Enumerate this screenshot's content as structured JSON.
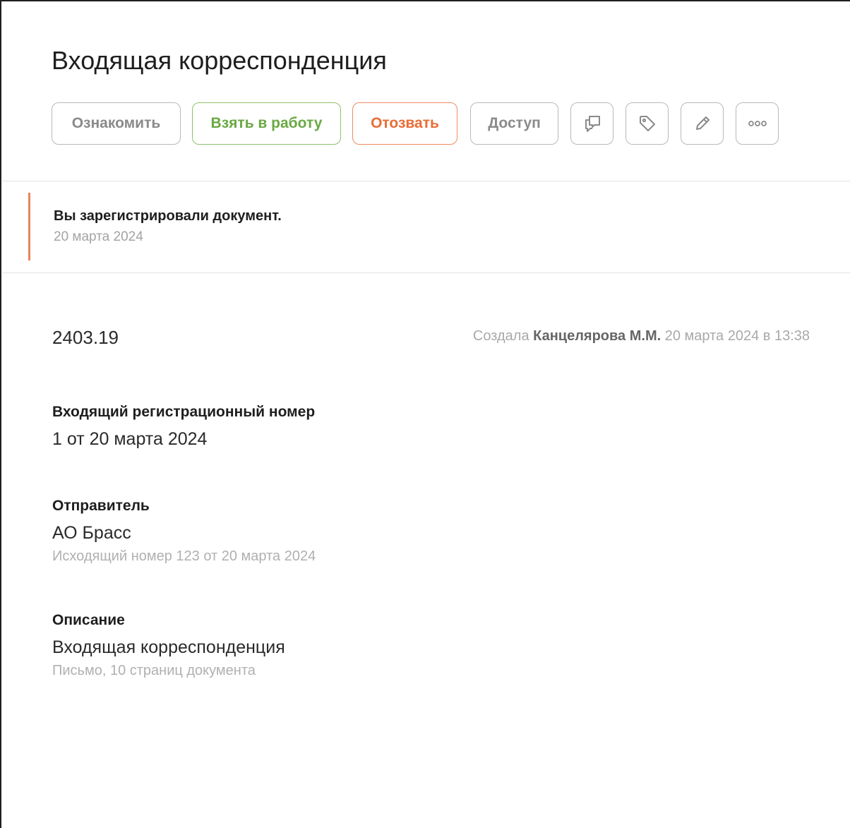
{
  "header": {
    "title": "Входящая корреспонденция"
  },
  "toolbar": {
    "familiarize_label": "Ознакомить",
    "take_to_work_label": "Взять в работу",
    "revoke_label": "Отозвать",
    "access_label": "Доступ",
    "icons": [
      "comments-icon",
      "tag-icon",
      "pencil-icon",
      "more-icon"
    ]
  },
  "event": {
    "text": "Вы зарегистрировали документ.",
    "date": "20 марта 2024"
  },
  "document": {
    "number": "2403.19",
    "created_prefix": "Создала",
    "created_author": "Канцелярова М.М.",
    "created_when": "20 марта 2024 в 13:38"
  },
  "fields": {
    "incoming_reg": {
      "label": "Входящий регистрационный номер",
      "value": "1 от 20 марта 2024"
    },
    "sender": {
      "label": "Отправитель",
      "value": "АО Брасс",
      "sub": "Исходящий номер 123 от 20 марта 2024"
    },
    "description": {
      "label": "Описание",
      "value": "Входящая корреспонденция",
      "sub": "Письмо, 10 страниц документа"
    }
  },
  "colors": {
    "accent_green": "#6aa843",
    "accent_orange": "#ea6c35",
    "event_marker": "#e8855a",
    "muted_text": "#a9a9a9"
  }
}
